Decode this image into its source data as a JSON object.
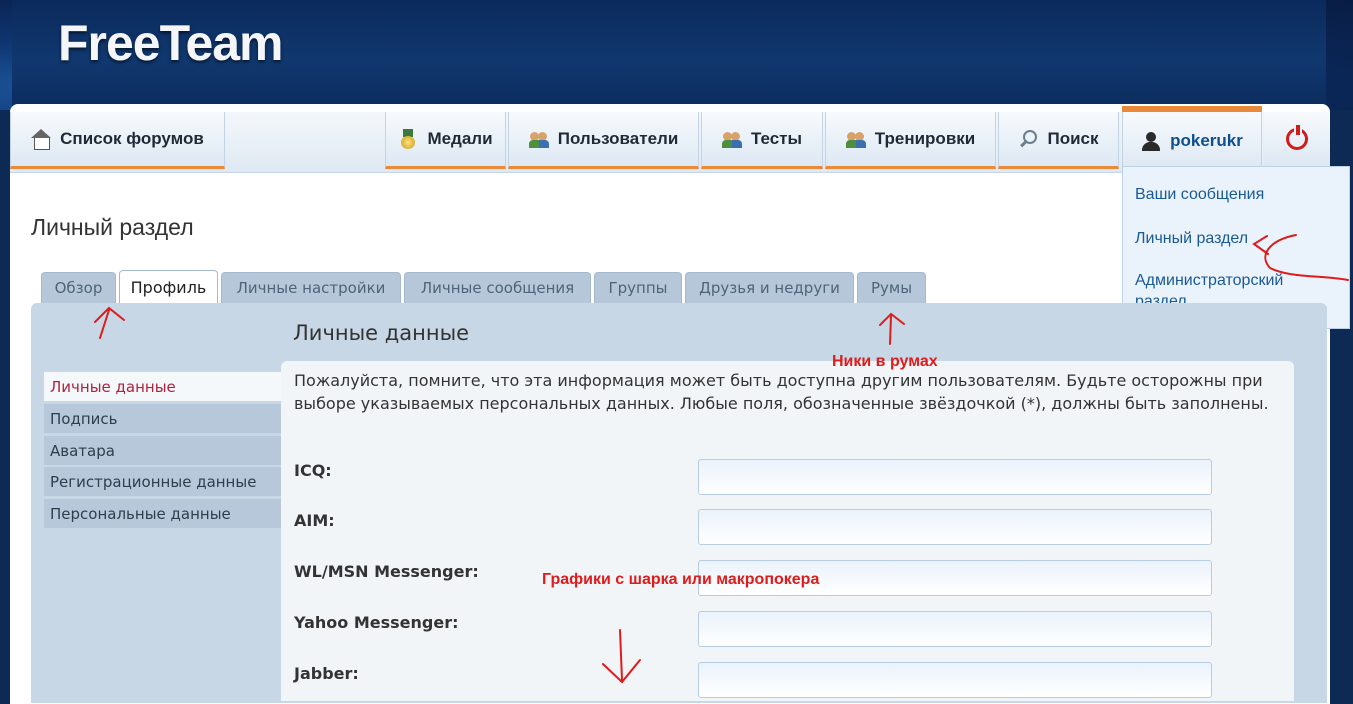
{
  "brand": {
    "logo_text": "FreeTeam"
  },
  "nav": {
    "items": [
      {
        "label": "Список форумов",
        "icon": "home-icon"
      },
      {
        "label": "Медали",
        "icon": "medal-icon"
      },
      {
        "label": "Пользователи",
        "icon": "users-icon"
      },
      {
        "label": "Тесты",
        "icon": "users-icon"
      },
      {
        "label": "Тренировки",
        "icon": "users-icon"
      },
      {
        "label": "Поиск",
        "icon": "search-icon"
      }
    ],
    "user": {
      "label": "pokerukr",
      "icon": "user-icon"
    },
    "logout_icon": "power-icon",
    "accent_color": "#e88a3a"
  },
  "user_menu": {
    "items": [
      "Ваши сообщения",
      "Личный раздел",
      "Администраторский",
      "раздел"
    ]
  },
  "page": {
    "title": "Личный раздел"
  },
  "tabs": [
    "Обзор",
    "Профиль",
    "Личные настройки",
    "Личные сообщения",
    "Группы",
    "Друзья и недруги",
    "Румы"
  ],
  "active_tab": "Профиль",
  "sidebar": {
    "items": [
      "Личные данные",
      "Подпись",
      "Аватара",
      "Регистрационные данные",
      "Персональные данные"
    ],
    "active": "Личные данные"
  },
  "content": {
    "section_title": "Личные данные",
    "notice": "Пожалуйста, помните, что эта информация может быть доступна другим пользователям. Будьте осторожны при выборе указываемых персональных данных. Любые поля, обозначенные звёздочкой (*), должны быть заполнены.",
    "fields": [
      {
        "label": "ICQ:",
        "value": ""
      },
      {
        "label": "AIM:",
        "value": ""
      },
      {
        "label": "WL/MSN Messenger:",
        "value": ""
      },
      {
        "label": "Yahoo Messenger:",
        "value": ""
      },
      {
        "label": "Jabber:",
        "value": ""
      }
    ]
  },
  "annotations": {
    "nicks": "Ники в румах",
    "charts": "Графики с шарка или макропокера",
    "color": "#e01b1b"
  }
}
